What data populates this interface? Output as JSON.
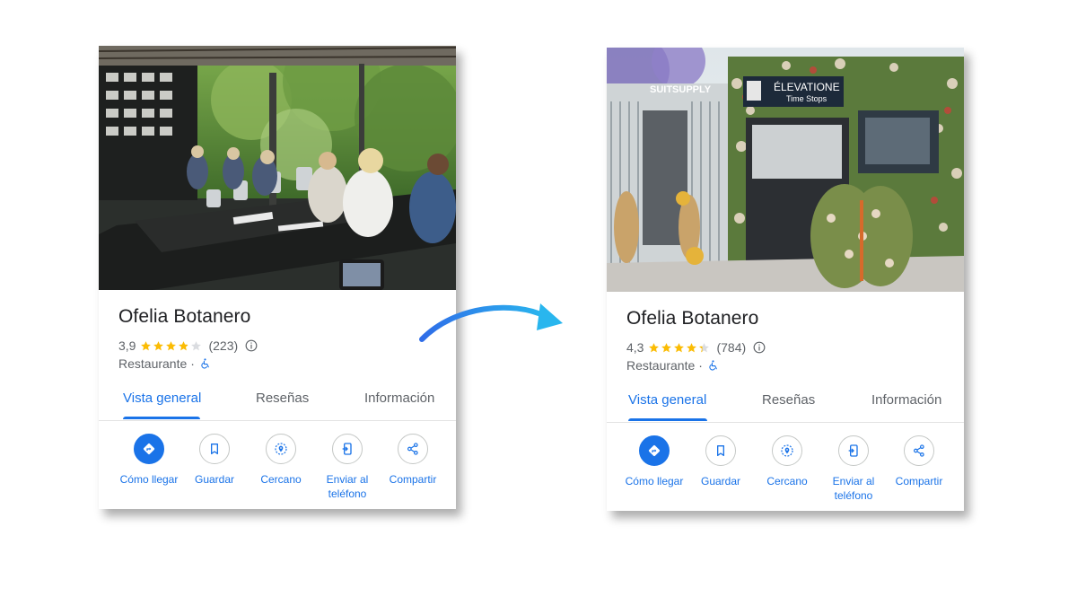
{
  "colors": {
    "accent": "#1a73e8",
    "star": "#fbbc04",
    "star_empty": "#dadce0",
    "text_primary": "#202124",
    "text_secondary": "#5f6368",
    "arrow_start": "#2f6de8",
    "arrow_end": "#29b6ee"
  },
  "before": {
    "title": "Ofelia Botanero",
    "rating": "3,9",
    "rating_value": 3.9,
    "review_count": "(223)",
    "category": "Restaurante",
    "separator": "·",
    "tabs": [
      "Vista general",
      "Reseñas",
      "Información"
    ],
    "actions": [
      {
        "icon": "directions-icon",
        "line1": "Cómo llegar",
        "line2": ""
      },
      {
        "icon": "bookmark-icon",
        "line1": "Guardar",
        "line2": ""
      },
      {
        "icon": "nearby-icon",
        "line1": "Cercano",
        "line2": ""
      },
      {
        "icon": "send-to-phone-icon",
        "line1": "Enviar al",
        "line2": "teléfono"
      },
      {
        "icon": "share-icon",
        "line1": "Compartir",
        "line2": ""
      }
    ]
  },
  "after": {
    "title": "Ofelia Botanero",
    "rating": "4,3",
    "rating_value": 4.3,
    "review_count": "(784)",
    "category": "Restaurante",
    "separator": "·",
    "storefront_signs": [
      "SUITSUPPLY",
      "ÉLEVATIONE",
      "Time Stops"
    ],
    "tabs": [
      "Vista general",
      "Reseñas",
      "Información"
    ],
    "actions": [
      {
        "icon": "directions-icon",
        "line1": "Cómo llegar",
        "line2": ""
      },
      {
        "icon": "bookmark-icon",
        "line1": "Guardar",
        "line2": ""
      },
      {
        "icon": "nearby-icon",
        "line1": "Cercano",
        "line2": ""
      },
      {
        "icon": "send-to-phone-icon",
        "line1": "Enviar al",
        "line2": "teléfono"
      },
      {
        "icon": "share-icon",
        "line1": "Compartir",
        "line2": ""
      }
    ]
  }
}
